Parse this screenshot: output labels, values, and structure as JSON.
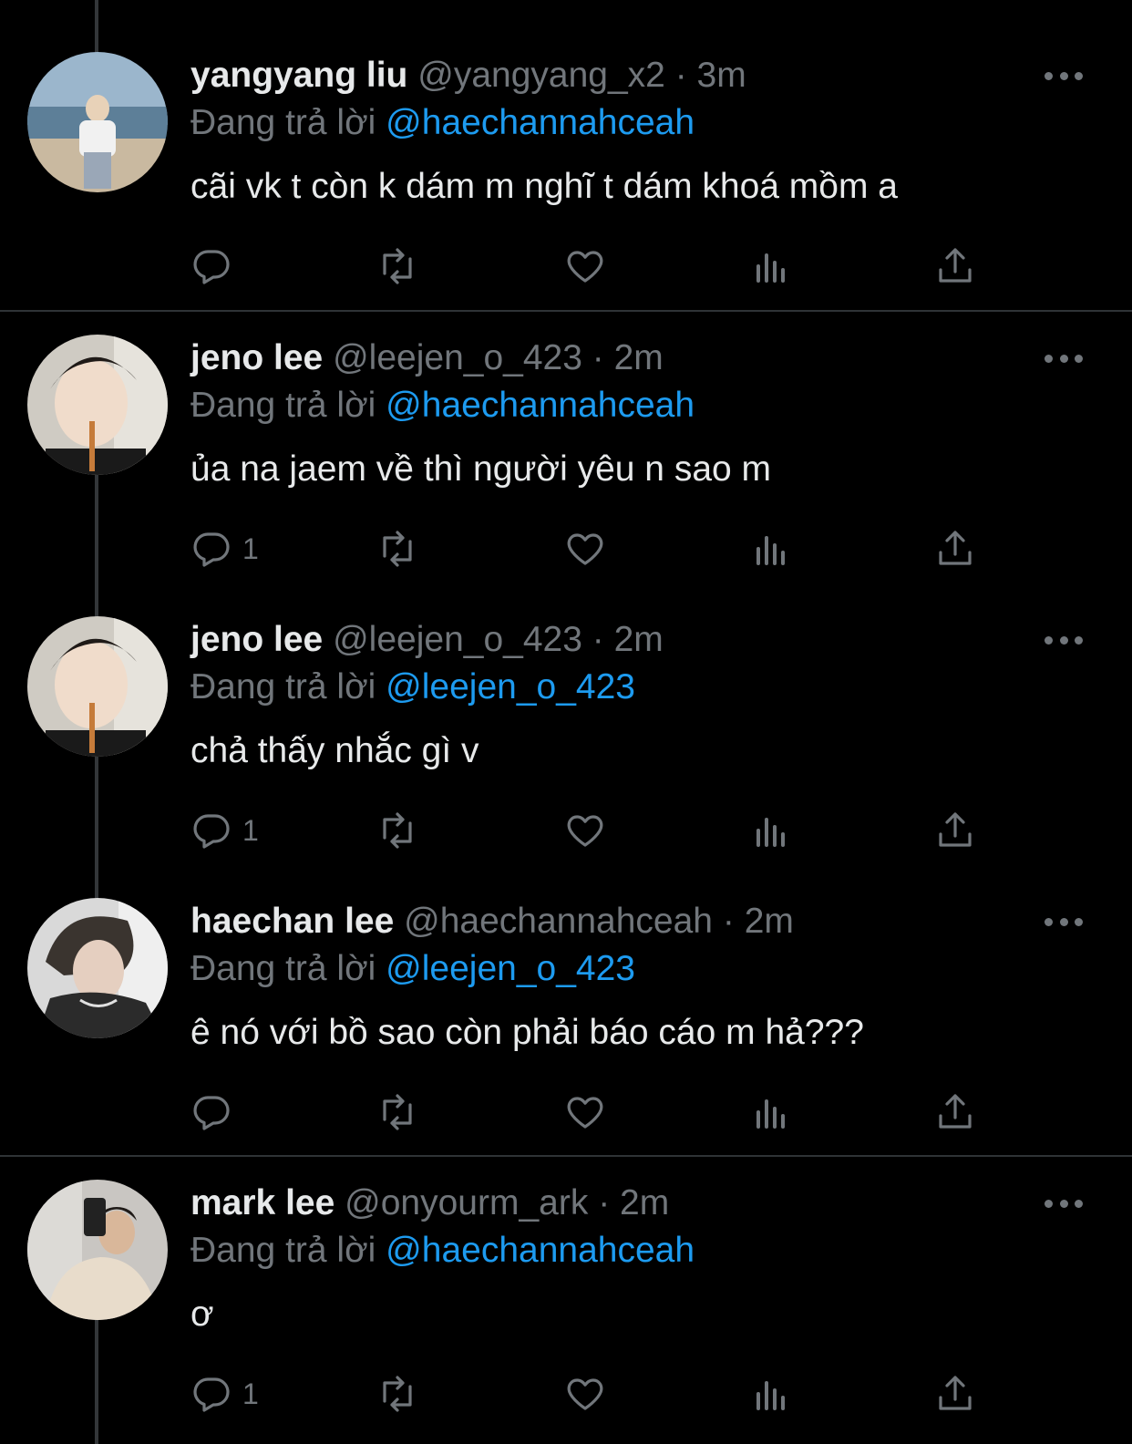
{
  "reply_prefix": "Đang trả lời",
  "tweets": [
    {
      "name": "yangyang liu",
      "handle": "@yangyang_x2",
      "dot": "·",
      "time": "3m",
      "reply_to": "@haechannahceah",
      "text": "cãi vk t còn k dám m nghĩ t dám khoá mồm a",
      "reply_count": ""
    },
    {
      "name": "jeno lee",
      "handle": "@leejen_o_423",
      "dot": "·",
      "time": "2m",
      "reply_to": "@haechannahceah",
      "text": "ủa na jaem về thì người yêu n sao m",
      "reply_count": "1"
    },
    {
      "name": "jeno lee",
      "handle": "@leejen_o_423",
      "dot": "·",
      "time": "2m",
      "reply_to": "@leejen_o_423",
      "text": "chả thấy nhắc gì v",
      "reply_count": "1"
    },
    {
      "name": "haechan lee",
      "handle": "@haechannahceah",
      "dot": "·",
      "time": "2m",
      "reply_to": "@leejen_o_423",
      "text": "ê nó với bồ sao còn phải báo cáo m hả???",
      "reply_count": ""
    },
    {
      "name": "mark lee",
      "handle": "@onyourm_ark",
      "dot": "·",
      "time": "2m",
      "reply_to": "@haechannahceah",
      "text": "ơ",
      "reply_count": "1"
    }
  ],
  "icons": {
    "reply": "reply-icon",
    "retweet": "retweet-icon",
    "like": "heart-icon",
    "views": "views-icon",
    "share": "share-icon",
    "more": "more-icon"
  },
  "colors": {
    "background": "#000000",
    "text": "#e7e9ea",
    "muted": "#71767b",
    "accent": "#1d9bf0",
    "divider": "#2f3336"
  }
}
